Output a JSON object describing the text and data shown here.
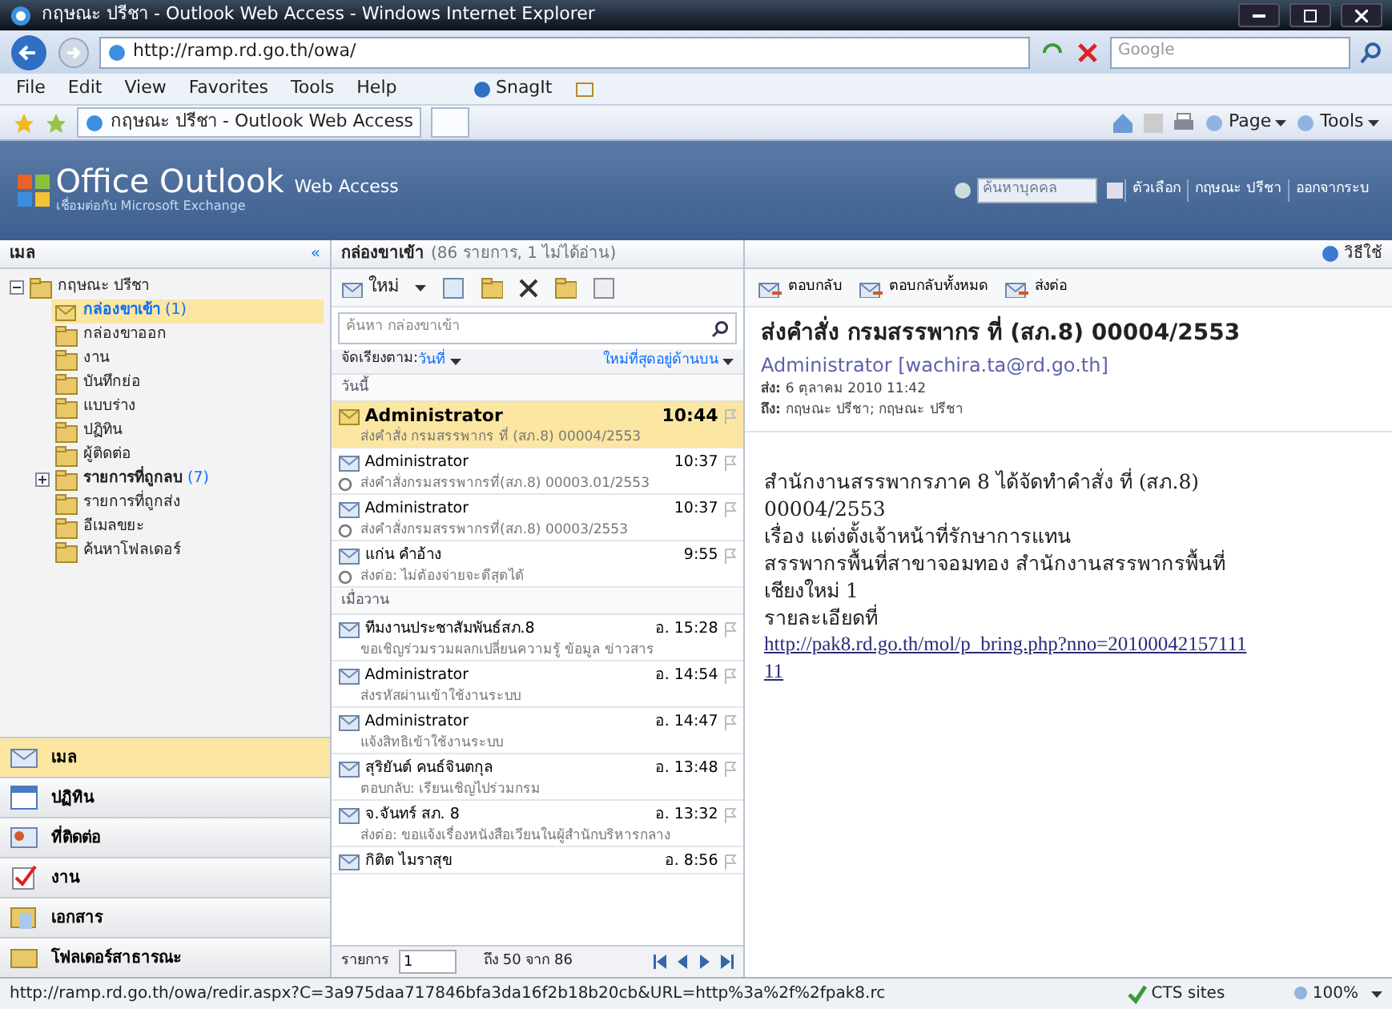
{
  "browser": {
    "title": "กฤษณะ ปรีชา - Outlook Web Access - Windows Internet Explorer",
    "address": "http://ramp.rd.go.th/owa/",
    "search_placeholder": "Google",
    "menu": [
      "File",
      "Edit",
      "View",
      "Favorites",
      "Tools",
      "Help"
    ],
    "snagit": "SnagIt",
    "tab": "กฤษณะ ปรีชา - Outlook Web Access",
    "commands": [
      "Page",
      "Tools"
    ]
  },
  "owa": {
    "brand": "Office Outlook",
    "brand_suffix": "Web Access",
    "tagline": "เชื่อมต่อกับ Microsoft Exchange",
    "people_search_placeholder": "ค้นหาบุคคล",
    "links": [
      "ตัวเลือก",
      "กฤษณะ ปรีชา",
      "ออกจากระบ"
    ],
    "help": "วิธีใช้"
  },
  "sidebar": {
    "title": "เมล",
    "collapse_button": "«",
    "folders": [
      {
        "label": "กฤษณะ ปรีชา",
        "expanded": true,
        "selected": false,
        "children": [
          {
            "label": "กล่องขาเข้า",
            "count": "(1)",
            "selected": true
          },
          {
            "label": "กล่องขาออก",
            "selected": false
          },
          {
            "label": "งาน",
            "selected": false
          },
          {
            "label": "บันทึกย่อ",
            "selected": false
          },
          {
            "label": "แบบร่าง",
            "selected": false
          },
          {
            "label": "ปฏิทิน",
            "selected": false
          },
          {
            "label": "ผู้ติดต่อ",
            "selected": false
          },
          {
            "label": "รายการที่ถูกลบ",
            "count": "(7)",
            "expanded": false,
            "selected": false
          },
          {
            "label": "รายการที่ถูกส่ง",
            "selected": false
          },
          {
            "label": "อีเมลขยะ",
            "selected": false
          },
          {
            "label": "ค้นหาโฟลเดอร์",
            "selected": false
          }
        ]
      }
    ],
    "nav": [
      {
        "label": "เมล",
        "selected": true
      },
      {
        "label": "ปฏิทิน",
        "selected": false
      },
      {
        "label": "ที่ติดต่อ",
        "selected": false
      },
      {
        "label": "งาน",
        "selected": false
      },
      {
        "label": "เอกสาร",
        "selected": false
      },
      {
        "label": "โฟลเดอร์สาธารณะ",
        "selected": false
      }
    ]
  },
  "message_list": {
    "title": "กล่องขาเข้า",
    "count": "(86 รายการ, 1 ไม่ได้อ่าน)",
    "new_button": "ใหม่",
    "search_placeholder": "ค้นหา กล่องขาเข้า",
    "sort_label": "จัดเรียงตาม:",
    "sort_value": "วันที่",
    "order": "ใหม่ที่สุดอยู่ด้านบน",
    "groups": [
      {
        "label": "วันนี้",
        "messages": [
          {
            "sender": "Administrator",
            "time": "10:44",
            "subject": "ส่งคำสั่ง กรมสรรพากร ที่ (สภ.8) 00004/2553",
            "unread": true,
            "selected": true,
            "attachment": false
          },
          {
            "sender": "Administrator",
            "time": "10:37",
            "subject": "ส่งคำสั่งกรมสรรพากรที่(สภ.8) 00003.01/2553",
            "unread": false,
            "selected": false,
            "attachment": true
          },
          {
            "sender": "Administrator",
            "time": "10:37",
            "subject": "ส่งคำสั่งกรมสรรพากรที่(สภ.8) 00003/2553",
            "unread": false,
            "selected": false,
            "attachment": true
          },
          {
            "sender": "แก่น คำอ้าง",
            "time": "9:55",
            "subject": "ส่งต่อ: ไม่ต้องจ่ายจะดีสุดได้",
            "unread": false,
            "selected": false,
            "attachment": true
          }
        ]
      },
      {
        "label": "เมื่อวาน",
        "messages": [
          {
            "sender": "ทีมงานประชาสัมพันธ์สภ.8",
            "time": "อ. 15:28",
            "subject": "ขอเชิญร่วมรวมผลกเปลี่ยนความรู้ ข้อมูล ข่าวสาร",
            "unread": false,
            "selected": false,
            "attachment": false
          },
          {
            "sender": "Administrator",
            "time": "อ. 14:54",
            "subject": "ส่งรหัสผ่านเข้าใช้งานระบบ",
            "unread": false,
            "selected": false,
            "attachment": false
          },
          {
            "sender": "Administrator",
            "time": "อ. 14:47",
            "subject": "แจ้งสิทธิเข้าใช้งานระบบ",
            "unread": false,
            "selected": false,
            "attachment": false
          },
          {
            "sender": "สุริยันต์ คนธ์จินตกุล",
            "time": "อ. 13:48",
            "subject": "ตอบกลับ: เรียนเชิญไปร่วมกรม",
            "unread": false,
            "selected": false,
            "attachment": false
          },
          {
            "sender": "จ.จันทร์ สภ. 8",
            "time": "อ. 13:32",
            "subject": "ส่งต่อ: ขอแจ้งเรื่องหนังสือเวียนในผู้สำนักบริหารกลาง",
            "unread": false,
            "selected": false,
            "attachment": false
          },
          {
            "sender": "กิติต ไมราสุข",
            "time": "อ. 8:56",
            "unread": false,
            "selected": false,
            "attachment": false
          }
        ]
      }
    ],
    "pager_label": "รายการ",
    "pager_value": "1",
    "pager_range": "ถึง 50 จาก 86"
  },
  "reading_pane": {
    "actions": [
      "ตอบกลับ",
      "ตอบกลับทั้งหมด",
      "ส่งต่อ"
    ],
    "subject": "ส่งคำสั่ง กรมสรรพากร ที่ (สภ.8) 00004/2553",
    "from": "Administrator [wachira.ta@rd.go.th]",
    "sent_label": "ส่ง:",
    "sent": "6 ตุลาคม 2010 11:42",
    "to_label": "ถึง:",
    "to": "กฤษณะ ปรีชา; กฤษณะ ปรีชา",
    "body": [
      "สำนักงานสรรพากรภาค 8 ได้จัดทำคำสั่ง ที่ (สภ.8) 00004/2553",
      "เรื่อง แต่งตั้งเจ้าหน้าที่รักษาการแทน",
      "สรรพากรพื้นที่สาขาจอมทอง สำนักงานสรรพากรพื้นที่เชียงใหม่ 1"
    ],
    "link_label": "รายละเอียดที่",
    "link": "http://pak8.rd.go.th/mol/p_bring.php?nno=2010004215711111"
  },
  "status_bar": {
    "url": "http://ramp.rd.go.th/owa/redir.aspx?C=3a975daa717846bfa3da16f2b18b20cb&URL=http%3a%2f%2fpak8.rc",
    "zone": "CTS sites",
    "zoom": "100%"
  }
}
